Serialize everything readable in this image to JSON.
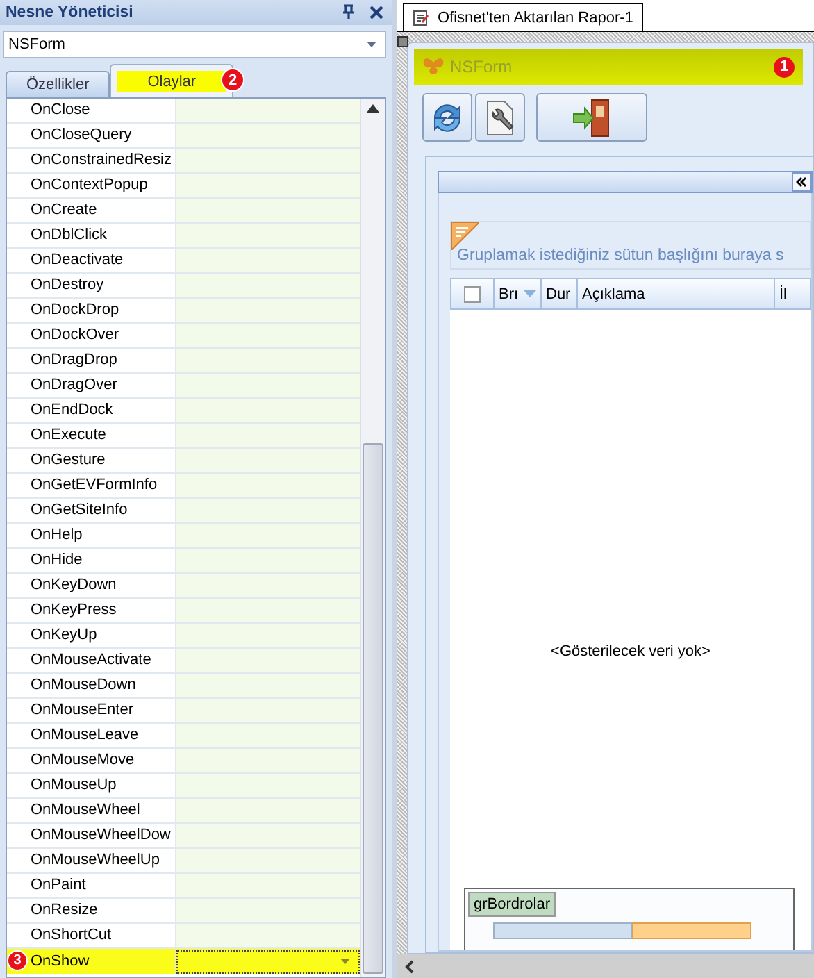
{
  "inspector": {
    "title": "Nesne Yöneticisi",
    "object_select": "NSForm",
    "tabs": [
      {
        "label": "Özellikler",
        "selected": false
      },
      {
        "label": "Olaylar",
        "selected": true,
        "badge": "2"
      }
    ],
    "events": [
      {
        "name": "OnClose",
        "selected": false
      },
      {
        "name": "OnCloseQuery",
        "selected": false
      },
      {
        "name": "OnConstrainedResiz",
        "selected": false
      },
      {
        "name": "OnContextPopup",
        "selected": false
      },
      {
        "name": "OnCreate",
        "selected": false
      },
      {
        "name": "OnDblClick",
        "selected": false
      },
      {
        "name": "OnDeactivate",
        "selected": false
      },
      {
        "name": "OnDestroy",
        "selected": false
      },
      {
        "name": "OnDockDrop",
        "selected": false
      },
      {
        "name": "OnDockOver",
        "selected": false
      },
      {
        "name": "OnDragDrop",
        "selected": false
      },
      {
        "name": "OnDragOver",
        "selected": false
      },
      {
        "name": "OnEndDock",
        "selected": false
      },
      {
        "name": "OnExecute",
        "selected": false
      },
      {
        "name": "OnGesture",
        "selected": false
      },
      {
        "name": "OnGetEVFormInfo",
        "selected": false
      },
      {
        "name": "OnGetSiteInfo",
        "selected": false
      },
      {
        "name": "OnHelp",
        "selected": false
      },
      {
        "name": "OnHide",
        "selected": false
      },
      {
        "name": "OnKeyDown",
        "selected": false
      },
      {
        "name": "OnKeyPress",
        "selected": false
      },
      {
        "name": "OnKeyUp",
        "selected": false
      },
      {
        "name": "OnMouseActivate",
        "selected": false
      },
      {
        "name": "OnMouseDown",
        "selected": false
      },
      {
        "name": "OnMouseEnter",
        "selected": false
      },
      {
        "name": "OnMouseLeave",
        "selected": false
      },
      {
        "name": "OnMouseMove",
        "selected": false
      },
      {
        "name": "OnMouseUp",
        "selected": false
      },
      {
        "name": "OnMouseWheel",
        "selected": false
      },
      {
        "name": "OnMouseWheelDow",
        "selected": false
      },
      {
        "name": "OnMouseWheelUp",
        "selected": false
      },
      {
        "name": "OnPaint",
        "selected": false
      },
      {
        "name": "OnResize",
        "selected": false
      },
      {
        "name": "OnShortCut",
        "selected": false
      },
      {
        "name": "OnShow",
        "selected": true,
        "badge": "3"
      }
    ]
  },
  "document_tab": {
    "label": "Ofisnet'ten Aktarılan Rapor-1",
    "selected": true
  },
  "form": {
    "title": "NSForm",
    "badge": "1",
    "group_prompt": "Gruplamak istediğiniz sütun başlığını buraya s",
    "select_all_checked": false,
    "columns": [
      "Brı",
      "Dur",
      "Açıklama",
      "İl"
    ],
    "empty_text": "<Gösterilecek veri yok>",
    "group_label": "grBordrolar"
  }
}
